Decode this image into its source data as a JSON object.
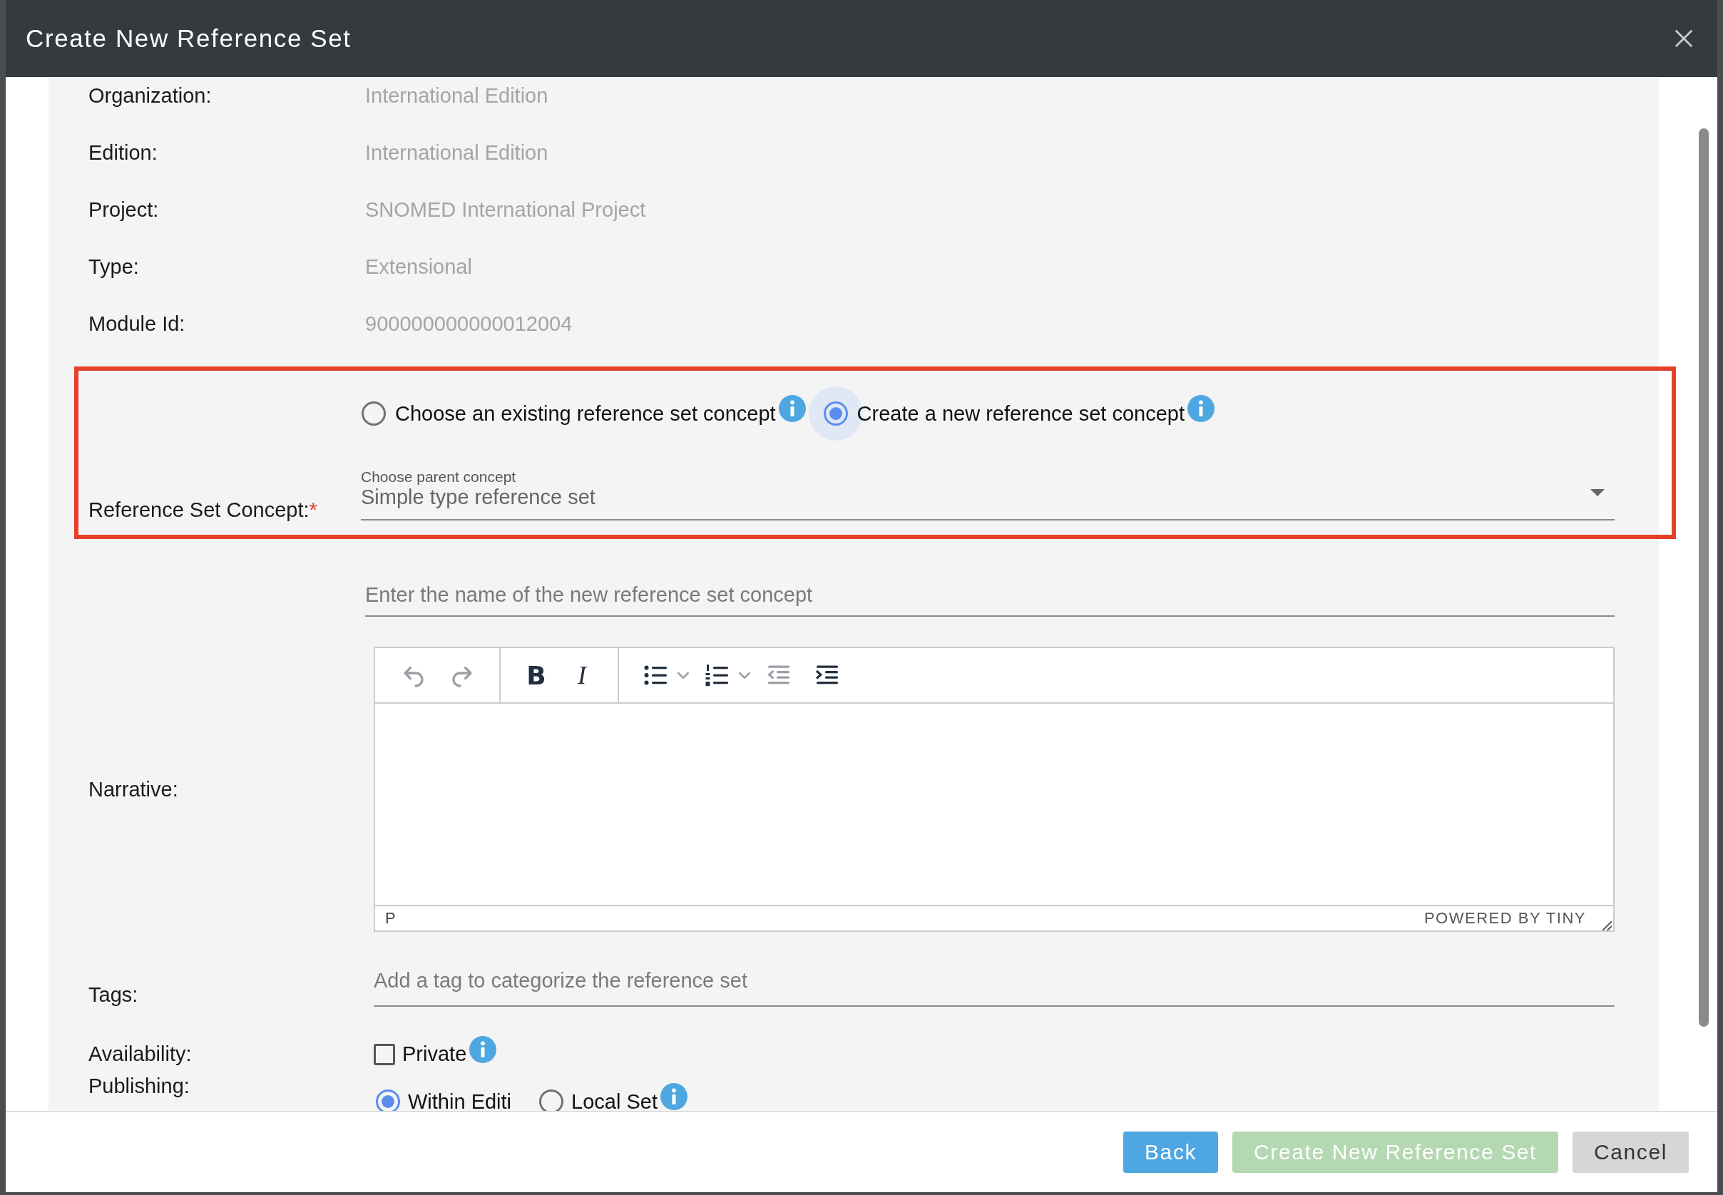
{
  "dialog": {
    "title": "Create New Reference Set"
  },
  "info_rows": [
    {
      "label": "Organization:",
      "value": "International Edition"
    },
    {
      "label": "Edition:",
      "value": "International Edition"
    },
    {
      "label": "Project:",
      "value": "SNOMED International Project"
    },
    {
      "label": "Type:",
      "value": "Extensional"
    },
    {
      "label": "Module Id:",
      "value": "900000000000012004"
    }
  ],
  "concept": {
    "label": "Reference Set Concept:",
    "required_mark": "*",
    "highlighted": true,
    "options": [
      {
        "label": "Choose an existing reference set concept",
        "selected": false
      },
      {
        "label": "Create a new reference set concept",
        "selected": true
      }
    ],
    "parent_select": {
      "floating_label": "Choose parent concept",
      "value": "Simple type reference set"
    }
  },
  "name_field": {
    "placeholder": "Enter the name of the new reference set concept"
  },
  "narrative": {
    "label": "Narrative:",
    "toolbar": [
      [
        {
          "kind": "undo",
          "disabled": true
        },
        {
          "kind": "redo",
          "disabled": true
        }
      ],
      [
        {
          "kind": "bold",
          "text": "B",
          "disabled": false
        },
        {
          "kind": "italic",
          "text": "I",
          "disabled": false
        }
      ],
      [
        {
          "kind": "bullets",
          "disabled": false
        },
        {
          "kind": "caret",
          "disabled": true
        },
        {
          "kind": "numbers",
          "disabled": false
        },
        {
          "kind": "caret",
          "disabled": true
        },
        {
          "kind": "outdent",
          "disabled": true
        },
        {
          "kind": "indent",
          "disabled": false
        }
      ]
    ],
    "path": "P",
    "branding": "POWERED BY TINY"
  },
  "tags": {
    "label": "Tags:",
    "placeholder": "Add a tag to categorize the reference set"
  },
  "availability": {
    "label": "Availability:",
    "option": "Private",
    "checked": false
  },
  "publishing": {
    "label": "Publishing:",
    "options": [
      {
        "label": "Within Editi",
        "selected": true
      },
      {
        "label": "Local Set",
        "selected": false
      }
    ]
  },
  "buttons": [
    {
      "label": "Back",
      "kind": "primary",
      "disabled": false
    },
    {
      "label": "Create New Reference Set",
      "kind": "success",
      "disabled": true
    },
    {
      "label": "Cancel",
      "kind": "secondary",
      "disabled": false
    }
  ]
}
